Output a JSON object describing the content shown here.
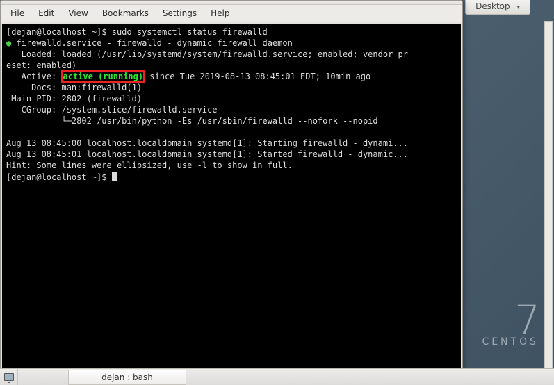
{
  "desktop": {
    "button_label": "Desktop",
    "brand_number": "7",
    "brand_name": "CENTOS"
  },
  "window": {
    "menus": {
      "file": "File",
      "edit": "Edit",
      "view": "View",
      "bookmarks": "Bookmarks",
      "settings": "Settings",
      "help": "Help"
    }
  },
  "term": {
    "prompt1_user": "[dejan@localhost ~]$ ",
    "cmd1": "sudo systemctl status firewalld",
    "bullet": "●",
    "svc_line": " firewalld.service - firewalld - dynamic firewall daemon",
    "loaded": "   Loaded: loaded (/usr/lib/systemd/system/firewalld.service; enabled; vendor pr",
    "eset": "eset: enabled)",
    "active_label": "   Active: ",
    "active_value": "active (running)",
    "active_rest": " since Tue 2019-08-13 08:45:01 EDT; 10min ago",
    "docs": "     Docs: man:firewalld(1)",
    "mainpid": " Main PID: 2802 (firewalld)",
    "cgroup": "   CGroup: /system.slice/firewalld.service",
    "cgroup_child": "           └─2802 /usr/bin/python -Es /usr/sbin/firewalld --nofork --nopid",
    "blank": "",
    "log1": "Aug 13 08:45:00 localhost.localdomain systemd[1]: Starting firewalld - dynami...",
    "log2": "Aug 13 08:45:01 localhost.localdomain systemd[1]: Started firewalld - dynamic...",
    "hint": "Hint: Some lines were ellipsized, use -l to show in full.",
    "prompt2_user": "[dejan@localhost ~]$ "
  },
  "taskbar": {
    "task_label": "dejan : bash"
  }
}
